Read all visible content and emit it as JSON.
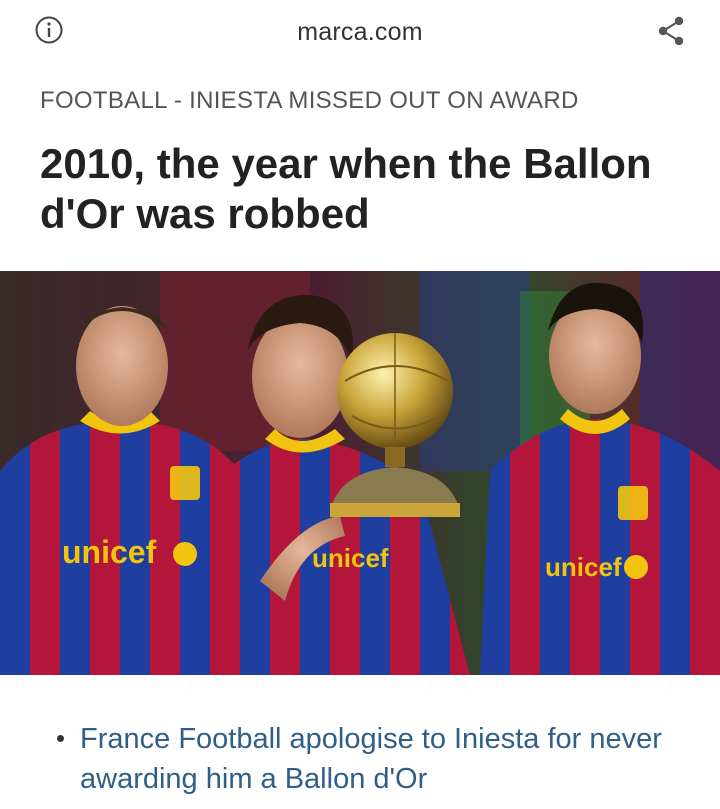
{
  "browser": {
    "domain": "marca.com",
    "info_icon": "info-icon",
    "share_icon": "share-icon"
  },
  "article": {
    "category": "FOOTBALL - INIESTA MISSED OUT ON AWARD",
    "headline": "2010, the year when the Ballon d'Or was robbed",
    "hero_image": {
      "jersey_text": [
        "unicef",
        "unicef",
        "unicef"
      ]
    },
    "related": [
      {
        "label": "France Football apologise to Iniesta for never awarding him a Ballon d'Or"
      }
    ]
  },
  "colors": {
    "link": "#2f5f88",
    "headline": "#222222",
    "category": "#555555",
    "jersey_blue": "#1f3fa0",
    "jersey_red": "#b3163a",
    "trophy_gold": "#c9a53a"
  }
}
